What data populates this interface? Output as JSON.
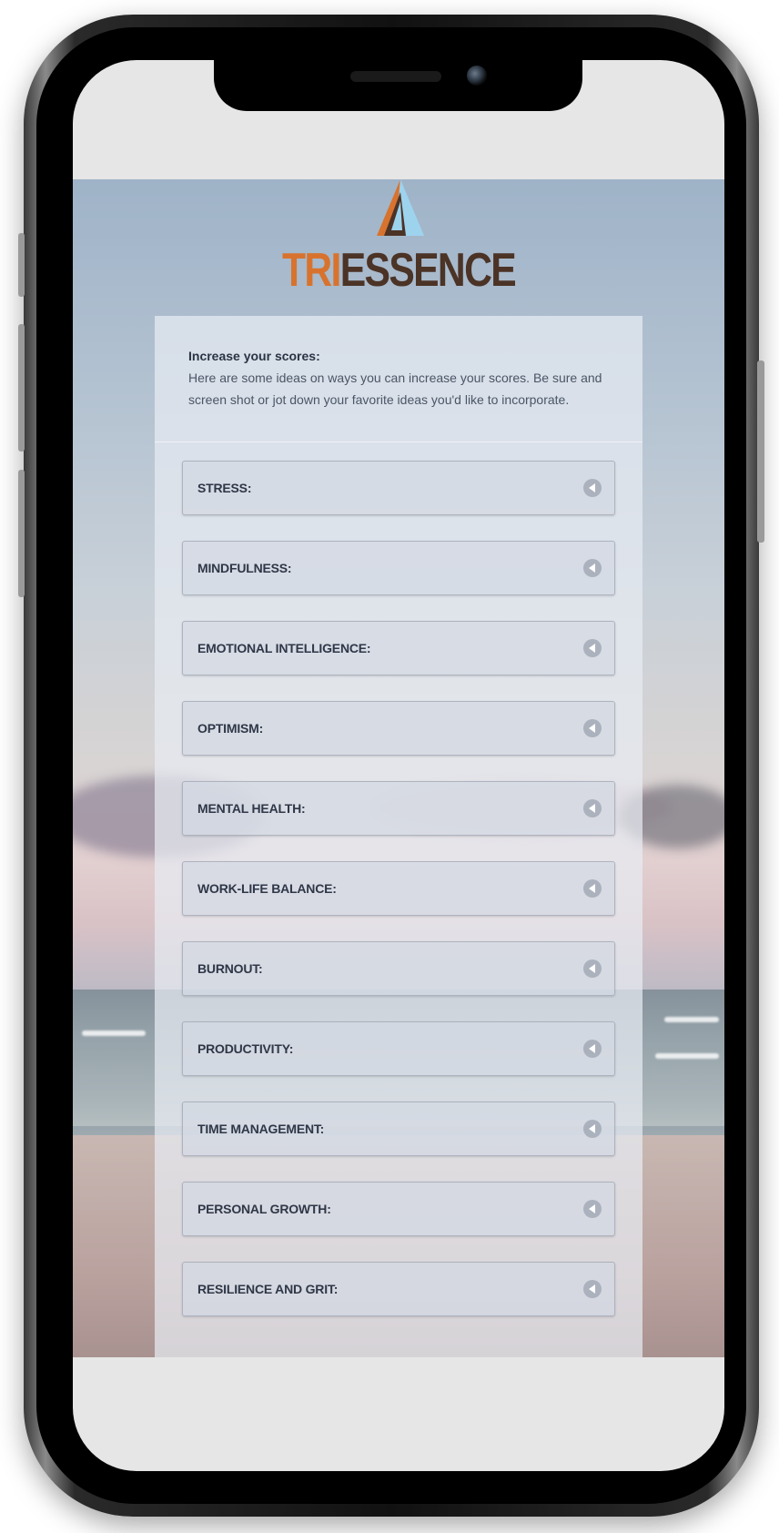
{
  "brand": {
    "name_part1": "TRI",
    "name_part2": "ESSENCE",
    "colors": {
      "orange": "#d7732e",
      "brown": "#4b3326",
      "light_blue": "#9ed3ee"
    }
  },
  "intro": {
    "title": "Increase your scores:",
    "text": "Here are some ideas on ways you can increase your scores. Be sure and screen shot or jot down your favorite ideas you'd like to incorporate."
  },
  "accordion": {
    "icon": "chevron-left-icon",
    "items": [
      {
        "label": "STRESS:"
      },
      {
        "label": "MINDFULNESS:"
      },
      {
        "label": "EMOTIONAL INTELLIGENCE:"
      },
      {
        "label": "OPTIMISM:"
      },
      {
        "label": "MENTAL HEALTH:"
      },
      {
        "label": "WORK-LIFE BALANCE:"
      },
      {
        "label": "BURNOUT:"
      },
      {
        "label": "PRODUCTIVITY:"
      },
      {
        "label": "TIME MANAGEMENT:"
      },
      {
        "label": "PERSONAL GROWTH:"
      },
      {
        "label": "RESILIENCE AND GRIT:"
      }
    ]
  }
}
